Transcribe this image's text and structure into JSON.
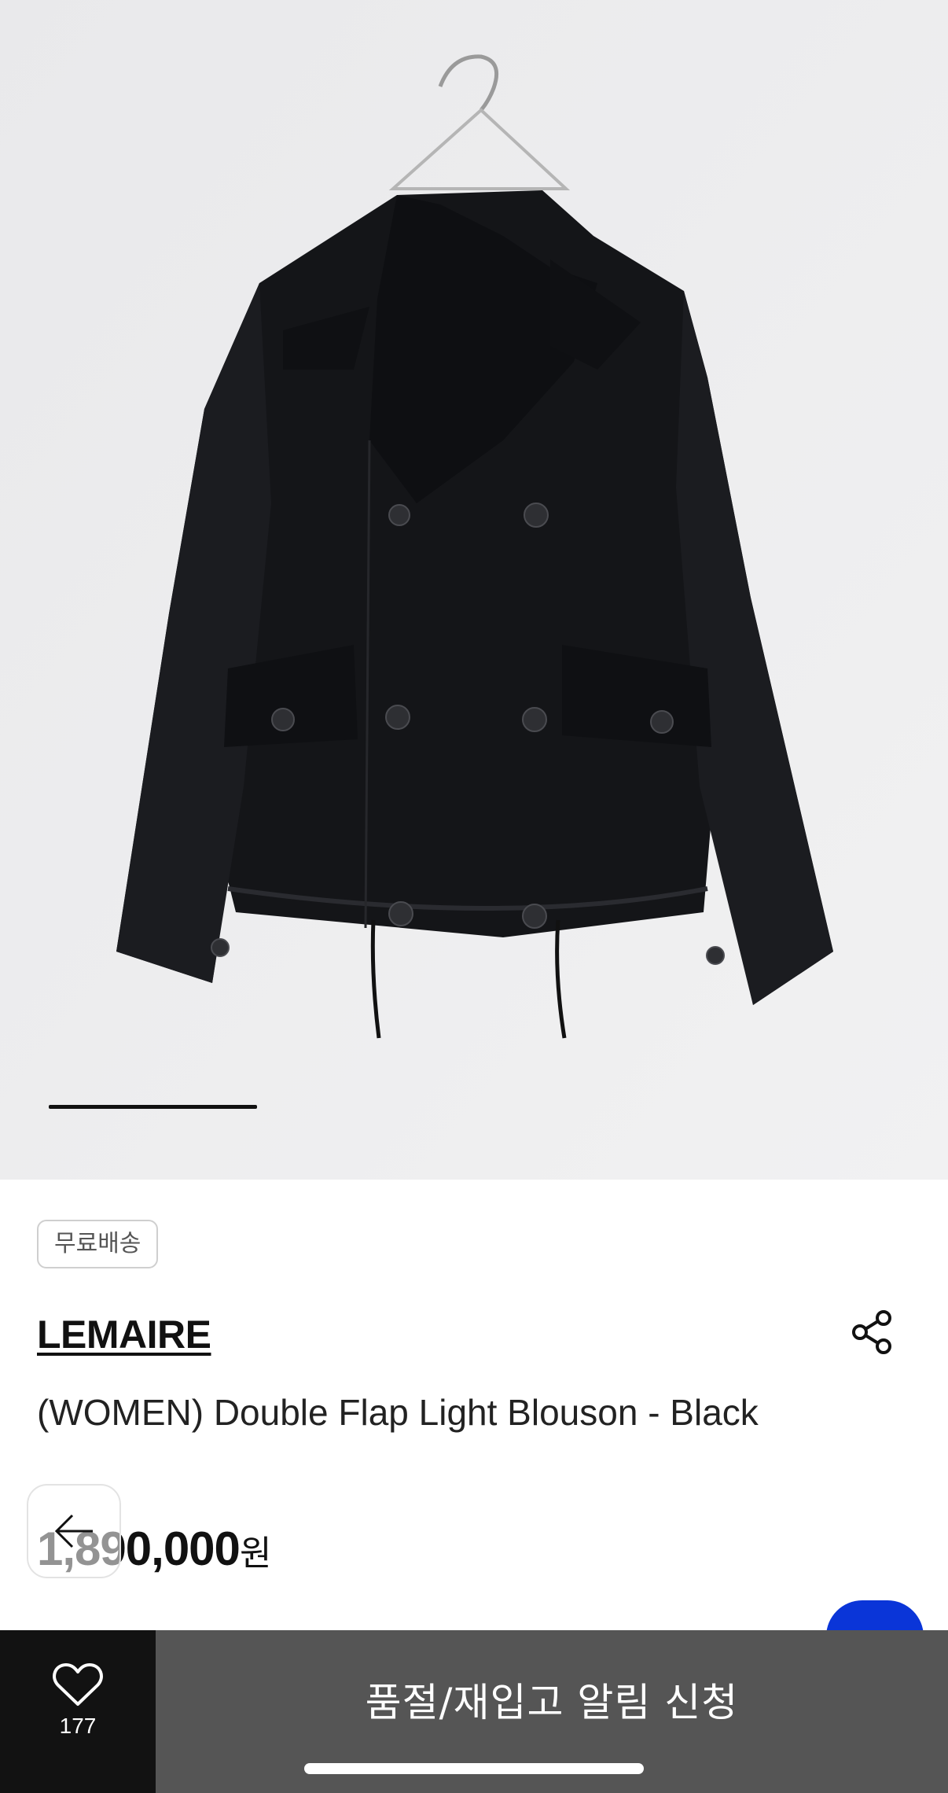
{
  "product_image": {
    "alt": "",
    "carousel_progress": 0.245
  },
  "badge": {
    "label": "무료배송"
  },
  "brand": {
    "name": "LEMAIRE"
  },
  "product": {
    "title": "(WOMEN) Double Flap Light Blouson - Black",
    "price_amount": "1,890,000",
    "price_unit": "원"
  },
  "icons": {
    "share": "share-icon",
    "back": "arrow-left-icon",
    "heart": "heart-icon"
  },
  "likes": {
    "count": "177"
  },
  "cta": {
    "label": "품절/재입고 알림 신청"
  },
  "colors": {
    "accent_blue": "#0a35d8",
    "cta_background": "#555555",
    "like_background": "#121212"
  }
}
